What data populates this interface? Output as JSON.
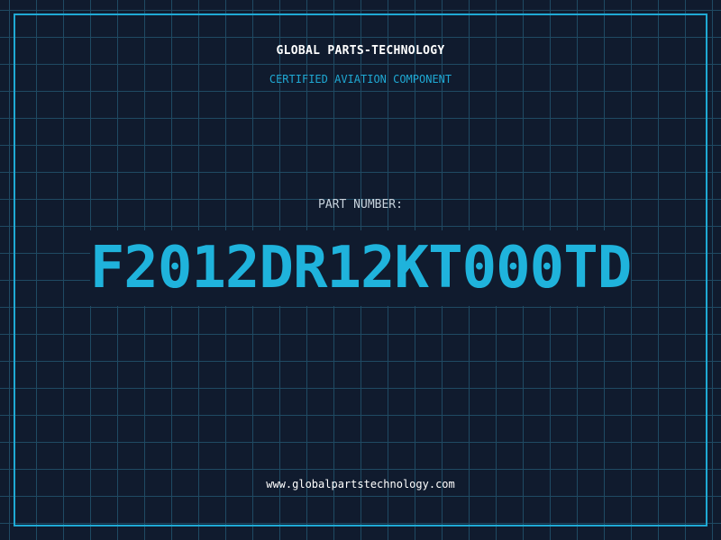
{
  "header": {
    "company": "GLOBAL PARTS-TECHNOLOGY",
    "tagline": "CERTIFIED AVIATION COMPONENT"
  },
  "part": {
    "label": "PART NUMBER:",
    "number": "F2012DR12KT000TD"
  },
  "footer": {
    "website": "www.globalpartstechnology.com"
  },
  "colors": {
    "background": "#101b2e",
    "grid": "#1f4a63",
    "accent": "#1fb3dc",
    "text": "#ffffff"
  }
}
